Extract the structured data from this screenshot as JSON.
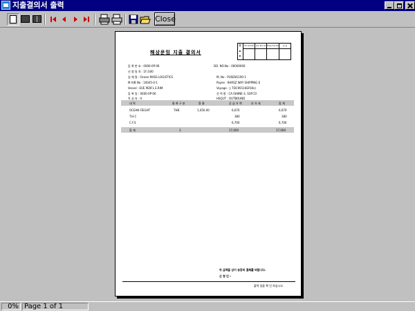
{
  "window": {
    "title": "지출결의서 출력"
  },
  "toolbar": {
    "close_label": "Close"
  },
  "document": {
    "title": "해상운임 지출 결의서",
    "approval_headers": [
      "Ch Conte",
      "Cm Ds ve",
      "Pres tre ter",
      "수 신"
    ],
    "approval_side": "결",
    "fields_left": [
      "등 록 번 호 : 0000-0P-06",
      "신 청 일 자 : 1F,G00",
      "업 체 명 : Ocean MASS LOGISTICS",
      "M A/B No : 10045-0-1",
      "Vessel : EVE PERFL E.RIM",
      "등 록 일 : 0000-0P-06",
      "작 성 자 : 0"
    ],
    "fields_right": [
      "DO. NO.No : 00000000",
      "M, No : PUSEN1190-1",
      "Payee : BARSZ WAY SHIPPING E",
      "Voyage : J. TDC99110EF60s)",
      "선 적 항 : CA ISHINE-3, SOFCO",
      "HSQUT : OUTBOUND"
    ],
    "table_headers": [
      "내 역",
      "통 화 구 분",
      "환 율",
      "공 급 가 액",
      "부 가 세",
      "합 계"
    ],
    "rows": [
      [
        "OCEAN FEIGHT",
        "THB",
        "1,050.00",
        "6,670",
        "",
        "6,670"
      ],
      [
        "T.H.C",
        "",
        "",
        "380",
        "",
        "380"
      ],
      [
        "C.F.S",
        "",
        "",
        "6,700",
        "",
        "6,700"
      ]
    ],
    "total": [
      "합 계",
      "3",
      "",
      "17,000",
      "",
      "17,000"
    ],
    "footer_notice": "위 금액을 상기 송장비 결제를 바랍니다.",
    "footer_sign": "신 청 인 :",
    "footer_final": "출력 일을 확 인 하십시오."
  },
  "status": {
    "percent": "0%",
    "page": "Page 1 of 1"
  },
  "icons": [
    "app-icon",
    "one-page-icon",
    "two-page-icon",
    "multi-page-icon",
    "first-page-icon",
    "prev-page-icon",
    "next-page-icon",
    "last-page-icon",
    "printer-setup-icon",
    "print-icon",
    "save-icon",
    "open-icon"
  ],
  "colors": {
    "titlebar": "#000080",
    "nav_arrows": "#cc0000",
    "chrome": "#c0c0c0"
  }
}
